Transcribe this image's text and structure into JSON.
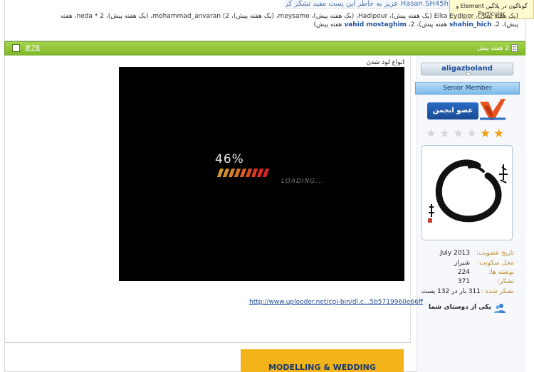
{
  "thanks_notice": "Hasan.SH45h عزیز به خاطر این پست مفید تشکر کرده اند.",
  "tooltip": {
    "line1": "گوناگون در پلاگین Element و",
    "line2": "Particular"
  },
  "thank_line_1": {
    "tail": "(یک هفته پیش)، Elka Eydipor (یک هفته پیش)، Hadipour، (یک هفته پیش)، meysamo، (یک هفته پیش)، mohammad_anvaran (2، (یک هفته پیش)، neda * 2، هفته",
    "users": [
      "Elka Eydipor",
      "Hadipour",
      "meysamo",
      "mohammad_anvaran",
      "neda"
    ]
  },
  "thank_line_2": {
    "text1": "پیش)، 2،",
    "user1": "shahin_hich",
    "text2": "هفته پیش)، 2،",
    "user2": "vahid mostaghim",
    "text3": "هفته پیش)"
  },
  "post": {
    "number": "#76",
    "date": "2 هفته پیش",
    "image_caption": "انواع لود شدن",
    "loading_percent": "46%",
    "loading_text": "LOADING...",
    "link": "http://www.uplooder.net/cgi-bin/dl.c...5b5719960e66ff",
    "signature_banner": "MODELLING & WEDDING"
  },
  "user": {
    "username": "aligazboland",
    "rank": "Senior Member",
    "badge_text": "عضو انجمن",
    "stars_on": 2,
    "stars_total": 6,
    "info": [
      {
        "label": "تاریخ عضویت:",
        "value": "July 2013"
      },
      {
        "label": "محل سکونت:",
        "value": "شیراز"
      },
      {
        "label": "نوشته ها:",
        "value": "224"
      },
      {
        "label": "تشکر:",
        "value": "371"
      },
      {
        "label": "تشکر شده :",
        "value": "311 بار در 132 پست"
      }
    ],
    "friend_text": "یکی از دوستای شما"
  },
  "colors": {
    "post_bar": "#8cc43a",
    "rank_bar": "#9fcdf2",
    "label": "#c08a2b",
    "link": "#1f4f9c",
    "banner": "#f2b31b"
  }
}
